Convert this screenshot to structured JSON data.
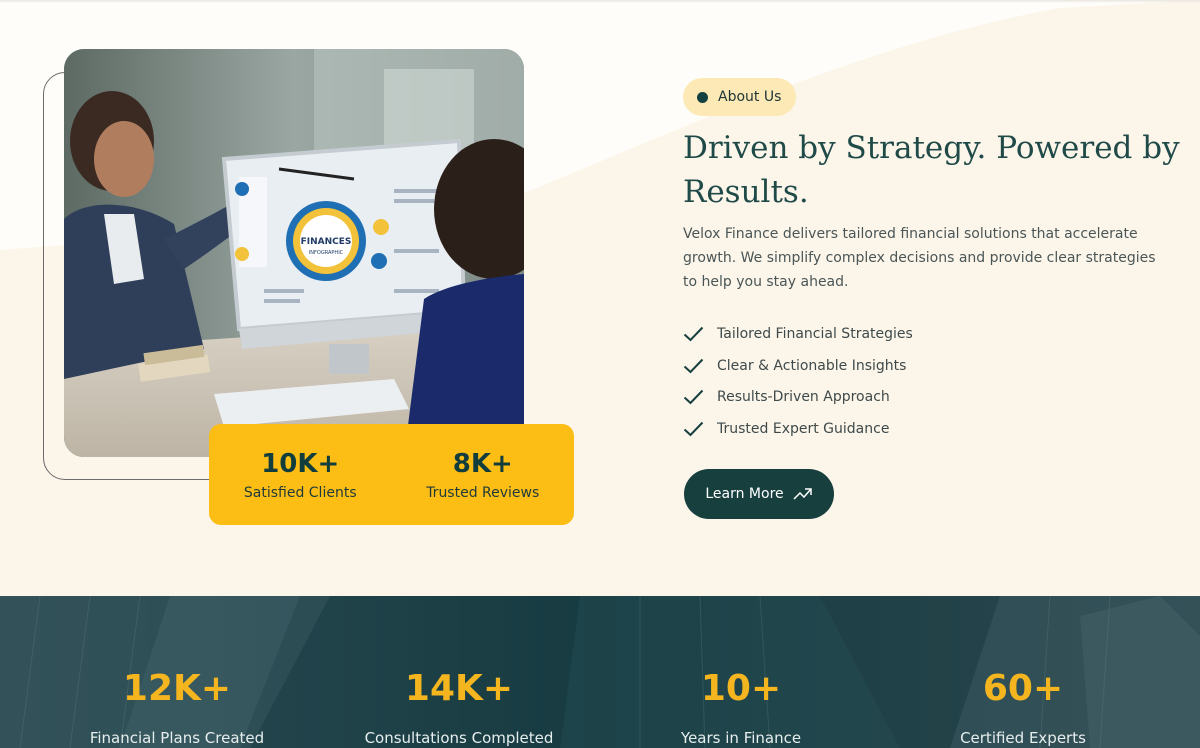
{
  "about": {
    "badge_label": "About Us",
    "headline": "Driven by Strategy. Powered by Results.",
    "description": "Velox Finance delivers tailored financial solutions that accelerate growth. We simplify complex decisions and provide clear strategies to help you stay ahead.",
    "features": [
      {
        "label": "Tailored Financial Strategies",
        "icon": "check-icon"
      },
      {
        "label": "Clear & Actionable Insights",
        "icon": "check-icon"
      },
      {
        "label": "Results-Driven Approach",
        "icon": "check-icon"
      },
      {
        "label": "Trusted Expert Guidance",
        "icon": "check-icon"
      }
    ],
    "cta": {
      "label": "Learn More",
      "icon": "trending-up-arrow-icon"
    }
  },
  "image_card": {
    "screen_text": "FINANCES",
    "screen_subtext": "INFOGRAPHIC",
    "stats": [
      {
        "value": "10K+",
        "label": "Satisfied Clients"
      },
      {
        "value": "8K+",
        "label": "Trusted Reviews"
      }
    ]
  },
  "counters": [
    {
      "value": "12K+",
      "label": "Financial Plans Created"
    },
    {
      "value": "14K+",
      "label": "Consultations Completed"
    },
    {
      "value": "10+",
      "label": "Years in Finance"
    },
    {
      "value": "60+",
      "label": "Certified Experts"
    }
  ],
  "colors": {
    "brand_dark": "#163f3e",
    "accent_yellow": "#fcbd14",
    "cream_background": "#fcf5ea",
    "counter_value": "#f4b51f"
  }
}
